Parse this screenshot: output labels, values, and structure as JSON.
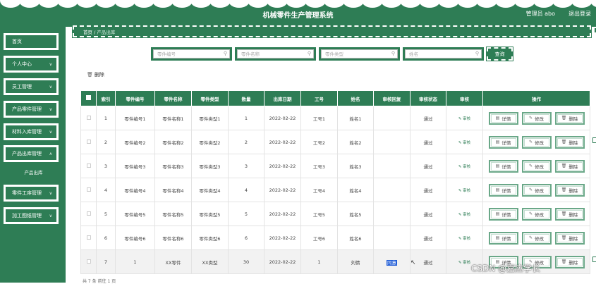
{
  "header": {
    "app_title": "机械零件生产管理系统",
    "user_label": "管理员 abo",
    "logout_label": "退出登录"
  },
  "breadcrumb": {
    "home": "首页",
    "separator": "/",
    "current": "产品出库"
  },
  "sidebar": {
    "items": [
      {
        "label": "首页",
        "has_chevron": false
      },
      {
        "label": "个人中心",
        "has_chevron": true
      },
      {
        "label": "员工管理",
        "has_chevron": true
      },
      {
        "label": "产品零件管理",
        "has_chevron": true
      },
      {
        "label": "材料入库管理",
        "has_chevron": true
      },
      {
        "label": "产品出库管理",
        "has_chevron": true,
        "expanded": true
      },
      {
        "label": "零件工序管理",
        "has_chevron": true
      },
      {
        "label": "加工图纸管理",
        "has_chevron": true
      }
    ],
    "subitem": "产品出库",
    "chevron_icon": "chevron-down-icon"
  },
  "search": {
    "fields": [
      {
        "placeholder": "零件编号"
      },
      {
        "placeholder": "零件名称"
      },
      {
        "placeholder": "零件类型"
      },
      {
        "placeholder": "姓名"
      }
    ],
    "search_icon": "search-icon",
    "query_label": "查询"
  },
  "toolbar": {
    "delete_label": "删除",
    "delete_icon": "trash-icon"
  },
  "table": {
    "headers": [
      "",
      "索引",
      "零件编号",
      "零件名称",
      "零件类型",
      "数量",
      "出库日期",
      "工号",
      "姓名",
      "审核回复",
      "审核状态",
      "审核",
      "操作"
    ],
    "audit_link": "审核",
    "ops": {
      "detail": "详情",
      "edit": "修改",
      "delete": "删除"
    },
    "rows": [
      {
        "index": "1",
        "part_no": "零件编号1",
        "part_name": "零件名称1",
        "part_type": "零件类型1",
        "qty": "1",
        "date": "2022-02-22",
        "emp_no": "工号1",
        "name": "姓名1",
        "reply": "",
        "status": "通过"
      },
      {
        "index": "2",
        "part_no": "零件编号2",
        "part_name": "零件名称2",
        "part_type": "零件类型2",
        "qty": "2",
        "date": "2022-02-22",
        "emp_no": "工号2",
        "name": "姓名2",
        "reply": "",
        "status": "通过"
      },
      {
        "index": "3",
        "part_no": "零件编号3",
        "part_name": "零件名称3",
        "part_type": "零件类型3",
        "qty": "3",
        "date": "2022-02-22",
        "emp_no": "工号3",
        "name": "姓名3",
        "reply": "",
        "status": "通过"
      },
      {
        "index": "4",
        "part_no": "零件编号4",
        "part_name": "零件名称4",
        "part_type": "零件类型4",
        "qty": "4",
        "date": "2022-02-22",
        "emp_no": "工号4",
        "name": "姓名4",
        "reply": "",
        "status": "通过"
      },
      {
        "index": "5",
        "part_no": "零件编号5",
        "part_name": "零件名称5",
        "part_type": "零件类型5",
        "qty": "5",
        "date": "2022-02-22",
        "emp_no": "工号5",
        "name": "姓名5",
        "reply": "",
        "status": "通过"
      },
      {
        "index": "6",
        "part_no": "零件编号6",
        "part_name": "零件名称6",
        "part_type": "零件类型6",
        "qty": "6",
        "date": "2022-02-22",
        "emp_no": "工号6",
        "name": "姓名6",
        "reply": "",
        "status": "通过"
      },
      {
        "index": "7",
        "part_no": "1",
        "part_name": "XX零件",
        "part_type": "XX类型",
        "qty": "30",
        "date": "2022-02-22",
        "emp_no": "1",
        "name": "刘倩",
        "reply": "同意",
        "status": "通过",
        "highlighted": true
      }
    ]
  },
  "pagination": {
    "total_label": "共 7 条",
    "page_label": "前往",
    "page_value": "1",
    "page_suffix": "页"
  },
  "watermark": "CSDN @嘉应学长",
  "colors": {
    "primary": "#2e7d55",
    "selection": "#1e5bd6"
  }
}
